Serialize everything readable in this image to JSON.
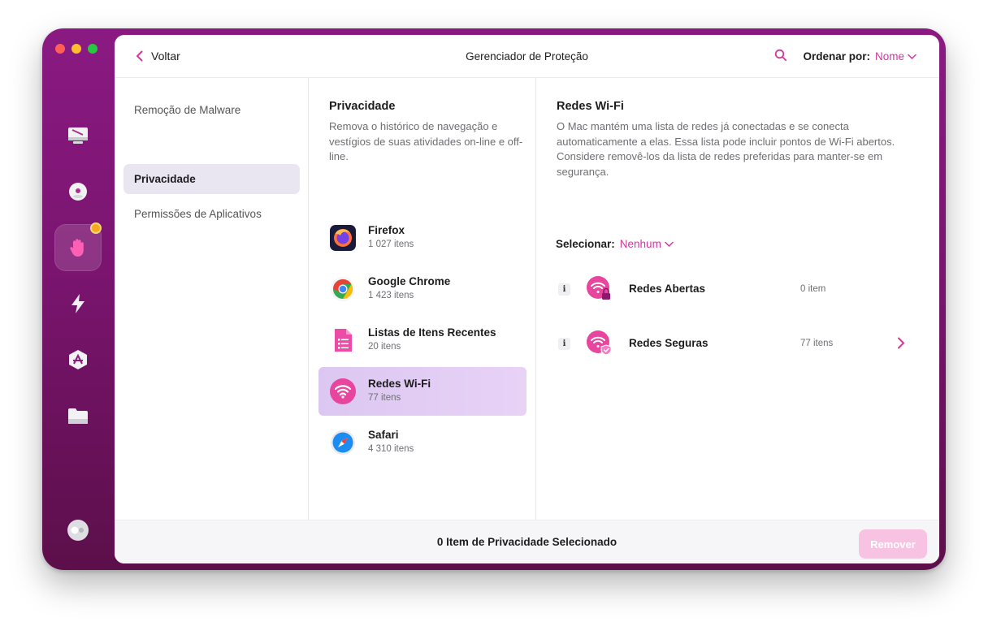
{
  "window": {
    "title": "Gerenciador de Proteção"
  },
  "topbar": {
    "back_label": "Voltar",
    "sort_label": "Ordenar por:",
    "sort_value": "Nome"
  },
  "sidebar": {
    "items": [
      {
        "label": "Remoção de Malware",
        "selected": false
      },
      {
        "label": "Privacidade",
        "selected": true
      },
      {
        "label": "Permissões de Aplicativos",
        "selected": false
      }
    ]
  },
  "privacy": {
    "title": "Privacidade",
    "description": "Remova o histórico de navegação e vestígios de suas atividades on-line e off-line.",
    "apps": [
      {
        "name": "Firefox",
        "count": "1 027 itens",
        "icon": "firefox-icon"
      },
      {
        "name": "Google Chrome",
        "count": "1 423 itens",
        "icon": "chrome-icon"
      },
      {
        "name": "Listas de Itens Recentes",
        "count": "20 itens",
        "icon": "recent-items-icon"
      },
      {
        "name": "Redes Wi-Fi",
        "count": "77 itens",
        "icon": "wifi-icon",
        "selected": true
      },
      {
        "name": "Safari",
        "count": "4 310 itens",
        "icon": "safari-icon"
      }
    ]
  },
  "detail": {
    "title": "Redes Wi-Fi",
    "description": "O Mac mantém uma lista de redes já conectadas e se conecta automaticamente a elas. Essa lista pode incluir pontos de Wi-Fi abertos. Considere removê-los da lista de redes preferidas para manter-se em segurança.",
    "select_label": "Selecionar:",
    "select_value": "Nenhum",
    "networks": [
      {
        "name": "Redes Abertas",
        "count": "0 item",
        "info": "i",
        "icon": "wifi-lock-icon"
      },
      {
        "name": "Redes Seguras",
        "count": "77 itens",
        "info": "i",
        "icon": "wifi-shield-icon"
      }
    ]
  },
  "footer": {
    "status": "0 Item de Privacidade Selecionado",
    "remove_label": "Remover"
  },
  "colors": {
    "accent": "#d0399c",
    "window_frame": "#7a146f",
    "selection": "#e9e6f1",
    "remove_button": "#f8c3e3"
  }
}
